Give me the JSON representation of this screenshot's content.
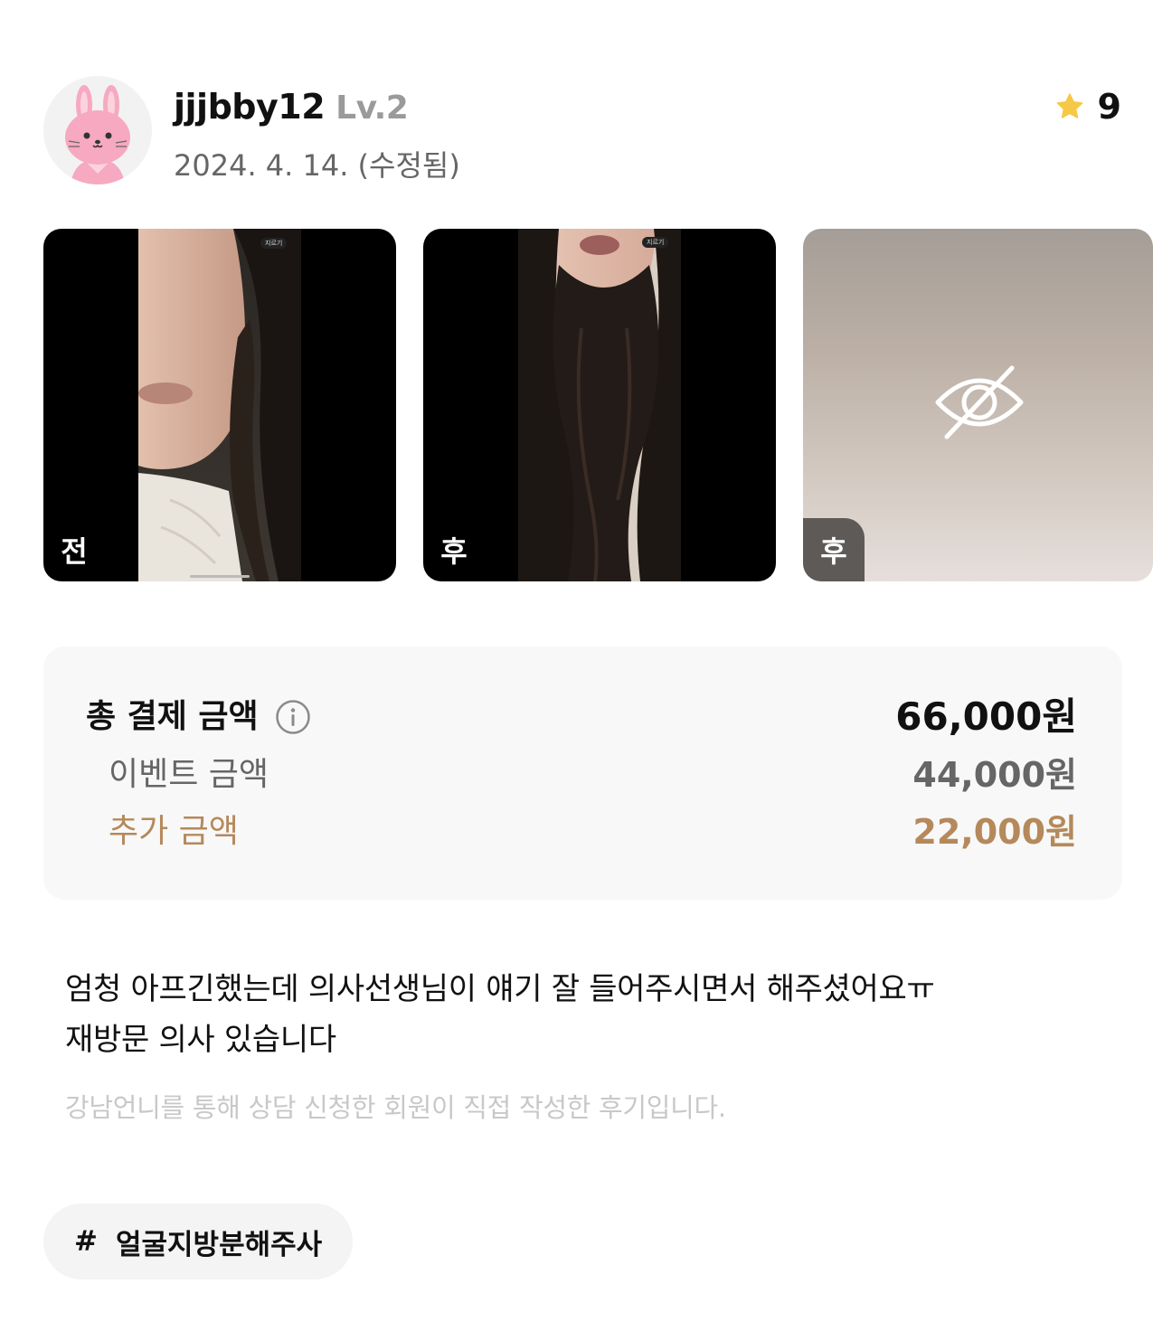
{
  "author": {
    "username": "jjjbby12",
    "level": "Lv.2",
    "date": "2024. 4. 14. (수정됨)",
    "avatar_icon": "bunny-avatar-icon"
  },
  "rating": {
    "icon": "star-icon",
    "value": "9",
    "star_color": "#F5C945"
  },
  "photos": [
    {
      "badge": "전",
      "overlay_hint": "지르기"
    },
    {
      "badge": "후",
      "overlay_hint": "지르기"
    },
    {
      "badge": "후",
      "hidden": true,
      "icon": "eye-slash-icon"
    }
  ],
  "pricing": {
    "total_label": "총 결제 금액",
    "total_value": "66,000원",
    "info_icon": "info-icon",
    "event_label": "이벤트 금액",
    "event_value": "44,000원",
    "extra_label": "추가 금액",
    "extra_value": "22,000원",
    "extra_color": "#B5895B"
  },
  "review": {
    "line1": "엄청 아프긴했는데 의사선생님이 얘기 잘 들어주시면서 해주셨어요ㅠ",
    "line2": "재방문 의사 있습니다",
    "disclaimer": "강남언니를 통해 상담 신청한 회원이 직접 작성한 후기입니다."
  },
  "tags": [
    {
      "hash": "#",
      "label": "얼굴지방분해주사"
    }
  ]
}
